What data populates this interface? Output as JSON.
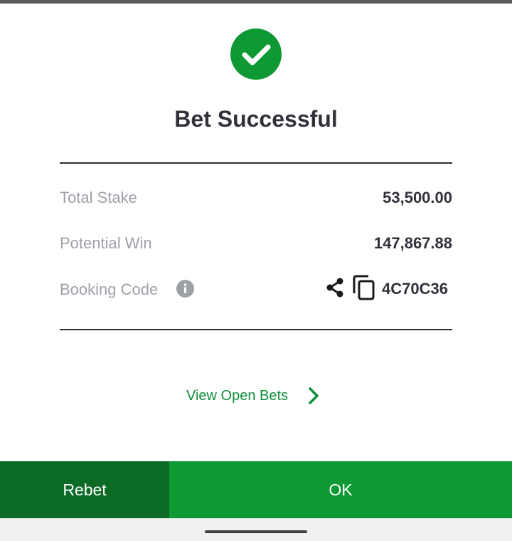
{
  "dialog": {
    "title": "Bet Successful",
    "rows": [
      {
        "label": "Total Stake",
        "value": "53,500.00"
      },
      {
        "label": "Potential Win",
        "value": "147,867.88"
      }
    ],
    "booking": {
      "label": "Booking Code",
      "code": "4C70C36"
    },
    "view_open_bets": "View Open Bets"
  },
  "buttons": {
    "rebet": "Rebet",
    "ok": "OK"
  },
  "icons": {
    "success": "check-circle-icon",
    "info": "info-icon",
    "share": "share-icon",
    "copy": "copy-icon",
    "chevron": "chevron-right-icon"
  },
  "colors": {
    "brand_green": "#0e9934",
    "dark_green": "#0b6b25",
    "link_green": "#108c3b",
    "title_text": "#30313b",
    "muted_text": "#9ea0a8"
  }
}
